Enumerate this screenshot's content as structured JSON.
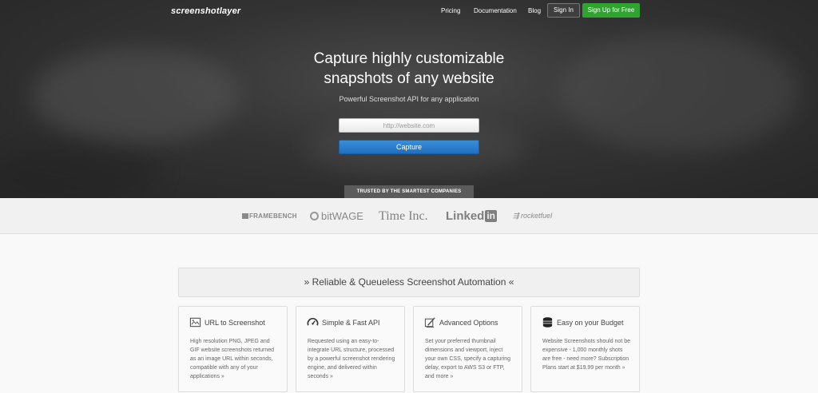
{
  "header": {
    "logo": "screenshotlayer",
    "nav": [
      {
        "label": "Pricing"
      },
      {
        "label": "Documentation"
      },
      {
        "label": "Blog"
      }
    ],
    "sign_in": "Sign In",
    "sign_up": "Sign Up for Free"
  },
  "hero": {
    "title_line1": "Capture highly customizable",
    "title_line2": "snapshots of any website",
    "subtitle": "Powerful Screenshot API for any application",
    "url_placeholder": "http://website.com",
    "capture_button": "Capture",
    "trusted_label": "TRUSTED BY THE SMARTEST COMPANIES"
  },
  "companies": [
    {
      "name": "FRAMEBENCH",
      "icon": "framebench-logo"
    },
    {
      "name": "bitWAGE",
      "icon": "bitwage-logo"
    },
    {
      "name": "Time Inc.",
      "icon": "timeinc-logo"
    },
    {
      "name": "Linked",
      "suffix": "in",
      "icon": "linkedin-logo"
    },
    {
      "name": "rocketfuel",
      "icon": "rocketfuel-logo"
    }
  ],
  "features": {
    "banner": "» Reliable & Queueless Screenshot Automation «",
    "cards": [
      {
        "title": "URL to Screenshot",
        "icon": "image-url-icon",
        "text": "High resolution PNG, JPEG and GIF website screenshots returned as an image URL within seconds, compatible with any of your applications »"
      },
      {
        "title": "Simple & Fast API",
        "icon": "speedometer-icon",
        "text": "Requested using an easy-to-integrate URL structure, processed by a powerful screenshot rendering engine, and delivered within seconds »"
      },
      {
        "title": "Advanced Options",
        "icon": "options-pencil-icon",
        "text": "Set your preferred thumbnail dimensions and viewport, inject your own CSS, specify a capturing delay, export to AWS S3 or FTP, and more »"
      },
      {
        "title": "Easy on your Budget",
        "icon": "coin-stack-icon",
        "text": "Website Screenshots should not be expensive - 1,000 monthly shots are free - need more? Subscription Plans start at $19.99 per month »"
      }
    ]
  },
  "colors": {
    "signup_green": "#2fa52f",
    "capture_blue": "#1f6fbf",
    "hero_dark": "#333333"
  }
}
